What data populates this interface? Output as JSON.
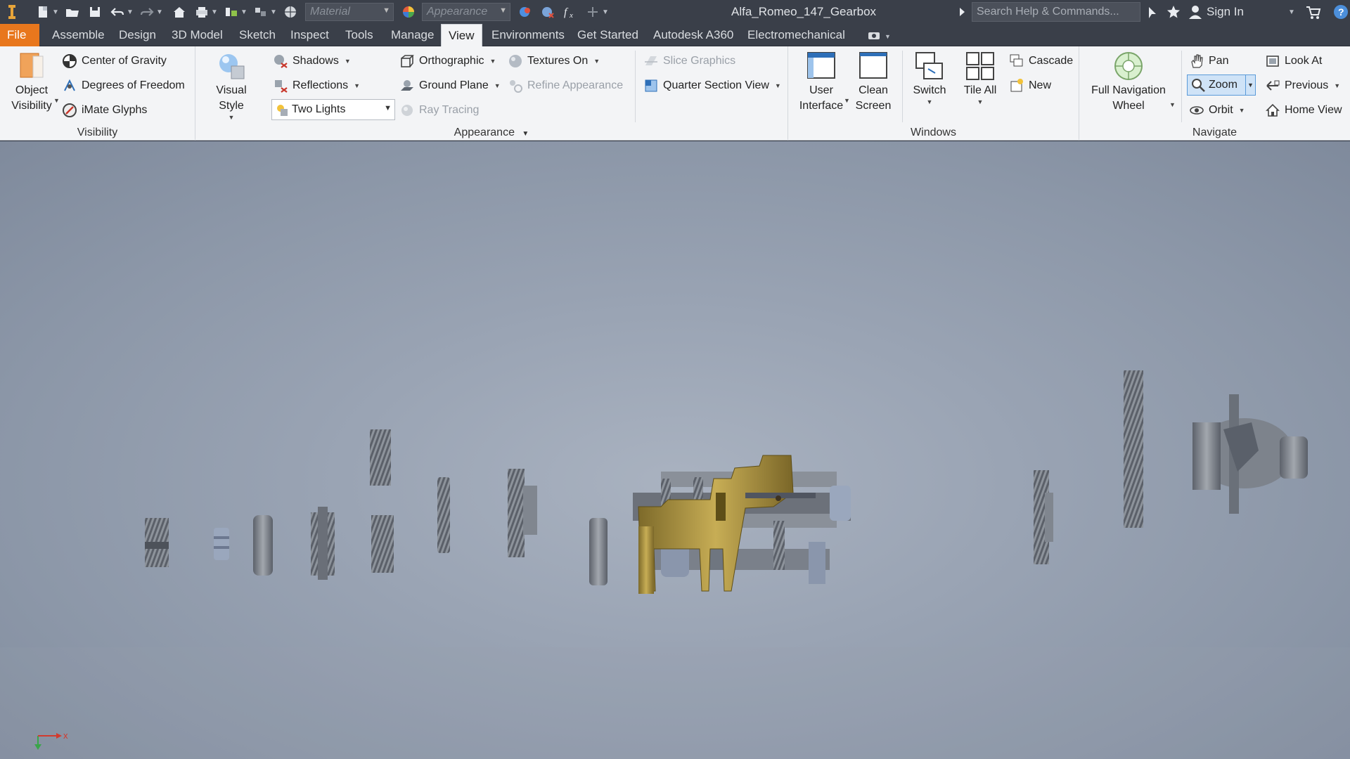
{
  "window": {
    "title": "Alfa_Romeo_147_Gearbox"
  },
  "quick_access": {
    "material_placeholder": "Material",
    "appearance_placeholder": "Appearance"
  },
  "search": {
    "placeholder": "Search Help & Commands..."
  },
  "account": {
    "sign_in": "Sign In"
  },
  "tabs": [
    {
      "label": "File"
    },
    {
      "label": "Assemble"
    },
    {
      "label": "Design"
    },
    {
      "label": "3D Model"
    },
    {
      "label": "Sketch"
    },
    {
      "label": "Inspect"
    },
    {
      "label": "Tools"
    },
    {
      "label": "Manage"
    },
    {
      "label": "View",
      "active": true
    },
    {
      "label": "Environments"
    },
    {
      "label": "Get Started"
    },
    {
      "label": "Autodesk A360"
    },
    {
      "label": "Electromechanical"
    }
  ],
  "ribbon": {
    "visibility": {
      "title": "Visibility",
      "object_visibility": "Object\nVisibility",
      "center_of_gravity": "Center of Gravity",
      "degrees_of_freedom": "Degrees of Freedom",
      "imate_glyphs": "iMate Glyphs"
    },
    "appearance": {
      "title": "Appearance",
      "visual_style": "Visual Style",
      "shadows": "Shadows",
      "reflections": "Reflections",
      "lighting_value": "Two Lights",
      "orthographic": "Orthographic",
      "ground_plane": "Ground Plane",
      "ray_tracing": "Ray Tracing",
      "textures_on": "Textures On",
      "refine_appearance": "Refine Appearance",
      "slice_graphics": "Slice Graphics",
      "quarter_section_view": "Quarter Section View"
    },
    "windows": {
      "title": "Windows",
      "user_interface": "User\nInterface",
      "clean_screen": "Clean\nScreen",
      "switch": "Switch",
      "tile_all": "Tile All",
      "cascade": "Cascade",
      "new": "New"
    },
    "navigate": {
      "title": "Navigate",
      "full_navigation_wheel": "Full Navigation\nWheel",
      "pan": "Pan",
      "zoom": "Zoom",
      "orbit": "Orbit",
      "look_at": "Look At",
      "previous": "Previous",
      "home_view": "Home View"
    }
  },
  "viewport": {
    "axis_x_label": "x"
  },
  "colors": {
    "file_tab": "#e8771d",
    "ribbon_bg": "#f3f4f6",
    "title_bar": "#3a3f49",
    "zoom_highlight": "#cfe3f7",
    "model_gold": "#a08a3c",
    "model_gray": "#6c717a"
  }
}
